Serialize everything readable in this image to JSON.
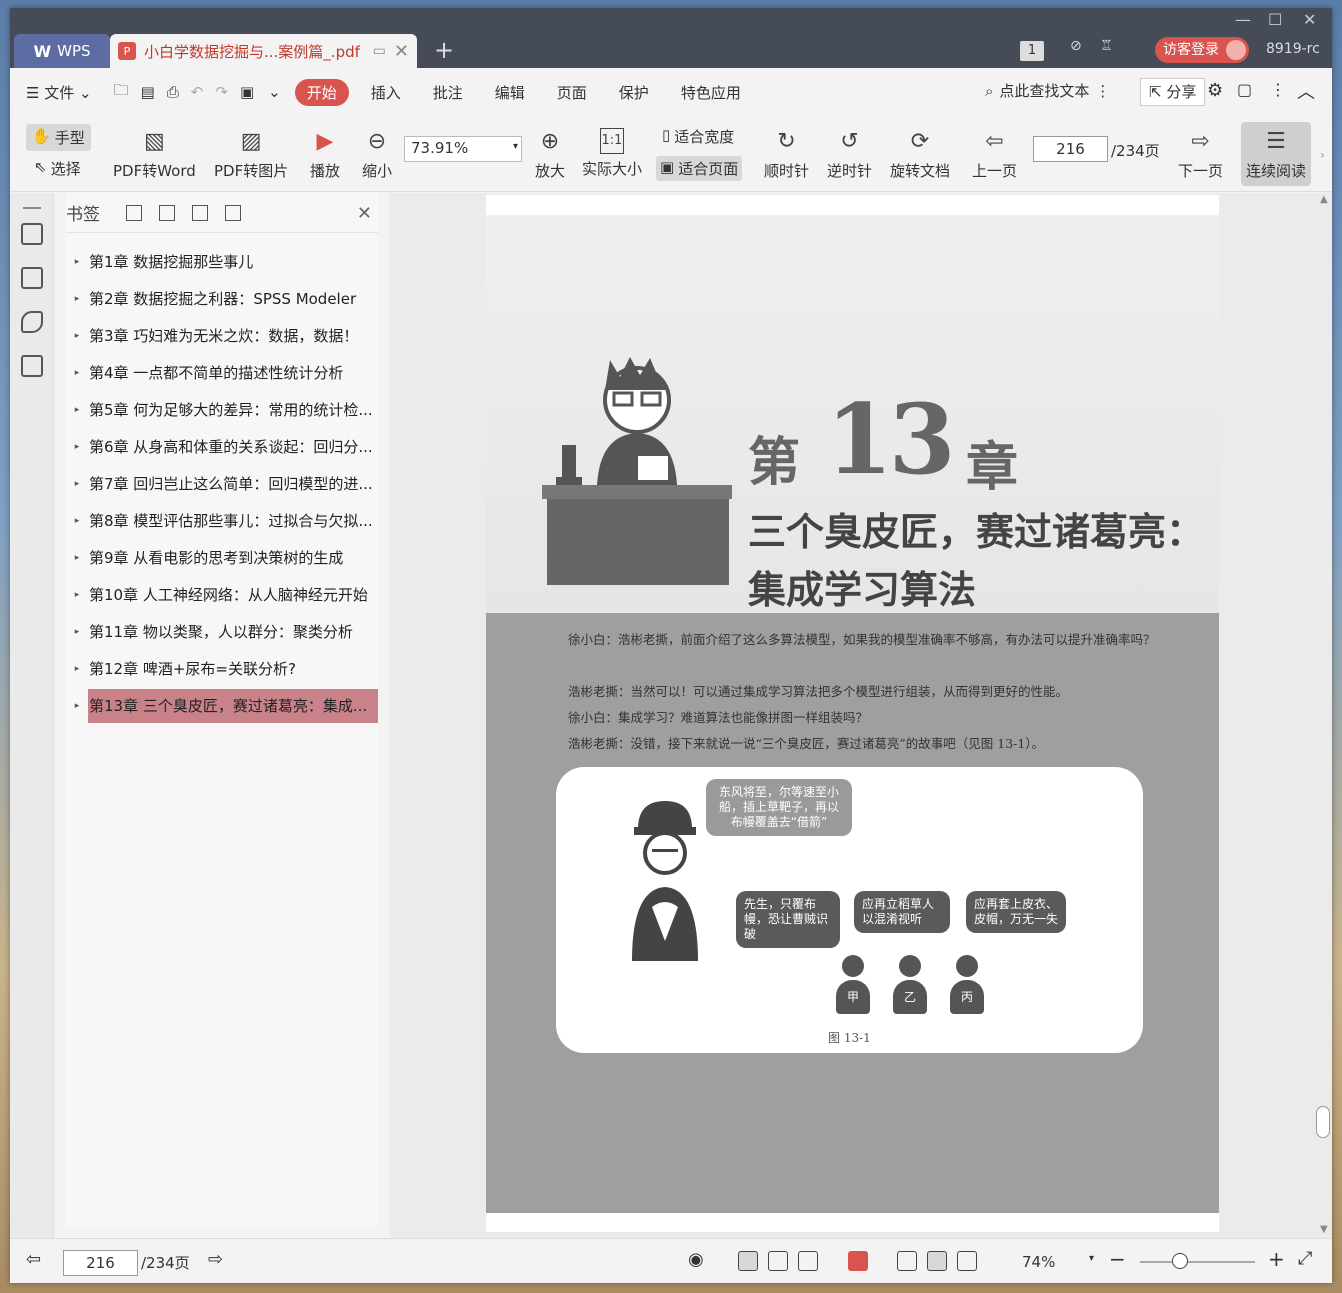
{
  "titlebar": {
    "app_tab": "WPS",
    "doc_tab": "小白学数据挖掘与...案例篇_.pdf",
    "page_count_badge": "1",
    "login": "访客登录",
    "user": "8919-rc"
  },
  "menubar": {
    "file": "文件",
    "items": [
      "开始",
      "插入",
      "批注",
      "编辑",
      "页面",
      "保护",
      "特色应用"
    ],
    "search": "点此查找文本",
    "share": "分享"
  },
  "toolbar": {
    "hand": "手型",
    "select": "选择",
    "pdf_to_word": "PDF转Word",
    "pdf_to_image": "PDF转图片",
    "play": "播放",
    "zoom_out": "缩小",
    "zoom_value": "73.91%",
    "zoom_in": "放大",
    "actual_size": "实际大小",
    "fit_width": "适合宽度",
    "fit_page": "适合页面",
    "clockwise": "顺时针",
    "counterclockwise": "逆时针",
    "rotate_doc": "旋转文档",
    "prev_page": "上一页",
    "page_value": "216",
    "page_total": "/234页",
    "next_page": "下一页",
    "continuous": "连续阅读"
  },
  "bookmarks": {
    "title": "书签",
    "items": [
      "第1章 数据挖掘那些事儿",
      "第2章 数据挖掘之利器：SPSS Modeler",
      "第3章 巧妇难为无米之炊：数据，数据！",
      "第4章 一点都不简单的描述性统计分析",
      "第5章 何为足够大的差异：常用的统计检...",
      "第6章 从身高和体重的关系谈起：回归分...",
      "第7章 回归岂止这么简单：回归模型的进...",
      "第8章 模型评估那些事儿：过拟合与欠拟...",
      "第9章 从看电影的思考到决策树的生成",
      "第10章 人工神经网络：从人脑神经元开始",
      "第11章 物以类聚，人以群分：聚类分析",
      "第12章 啤酒+尿布=关联分析?",
      "第13章 三个臭皮匠，赛过诸葛亮：集成..."
    ]
  },
  "page": {
    "chapter_di": "第",
    "chapter_num": "13",
    "chapter_zhang": "章",
    "subtitle1": "三个臭皮匠，赛过诸葛亮：",
    "subtitle2": "集成学习算法",
    "para1": "徐小白：浩彬老撕，前面介绍了这么多算法模型，如果我的模型准确率不够高，有办法可以提升准确率吗？",
    "para2": "浩彬老撕：当然可以！可以通过集成学习算法把多个模型进行组装，从而得到更好的性能。",
    "para3": "徐小白：集成学习？难道算法也能像拼图一样组装吗？",
    "para4": "浩彬老撕：没错，接下来就说一说“三个臭皮匠，赛过诸葛亮”的故事吧（见图 13-1）。",
    "bubble_top": "东风将至，尔等速至小船，插上草靶子，再以布幔覆盖去“借箭”",
    "bubble_a": "先生，只覆布幔，恐让曹贼识破",
    "bubble_b": "应再立稻草人以混淆视听",
    "bubble_c": "应再套上皮衣、皮帽，万无一失",
    "person_a": "甲",
    "person_b": "乙",
    "person_c": "丙",
    "figure_caption": "图 13-1"
  },
  "statusbar": {
    "page_value": "216",
    "page_total": "/234页",
    "zoom": "74%"
  },
  "colors": {
    "accent": "#d9534f",
    "title_bar": "#454b57",
    "bookmark_active": "#c9828a"
  }
}
